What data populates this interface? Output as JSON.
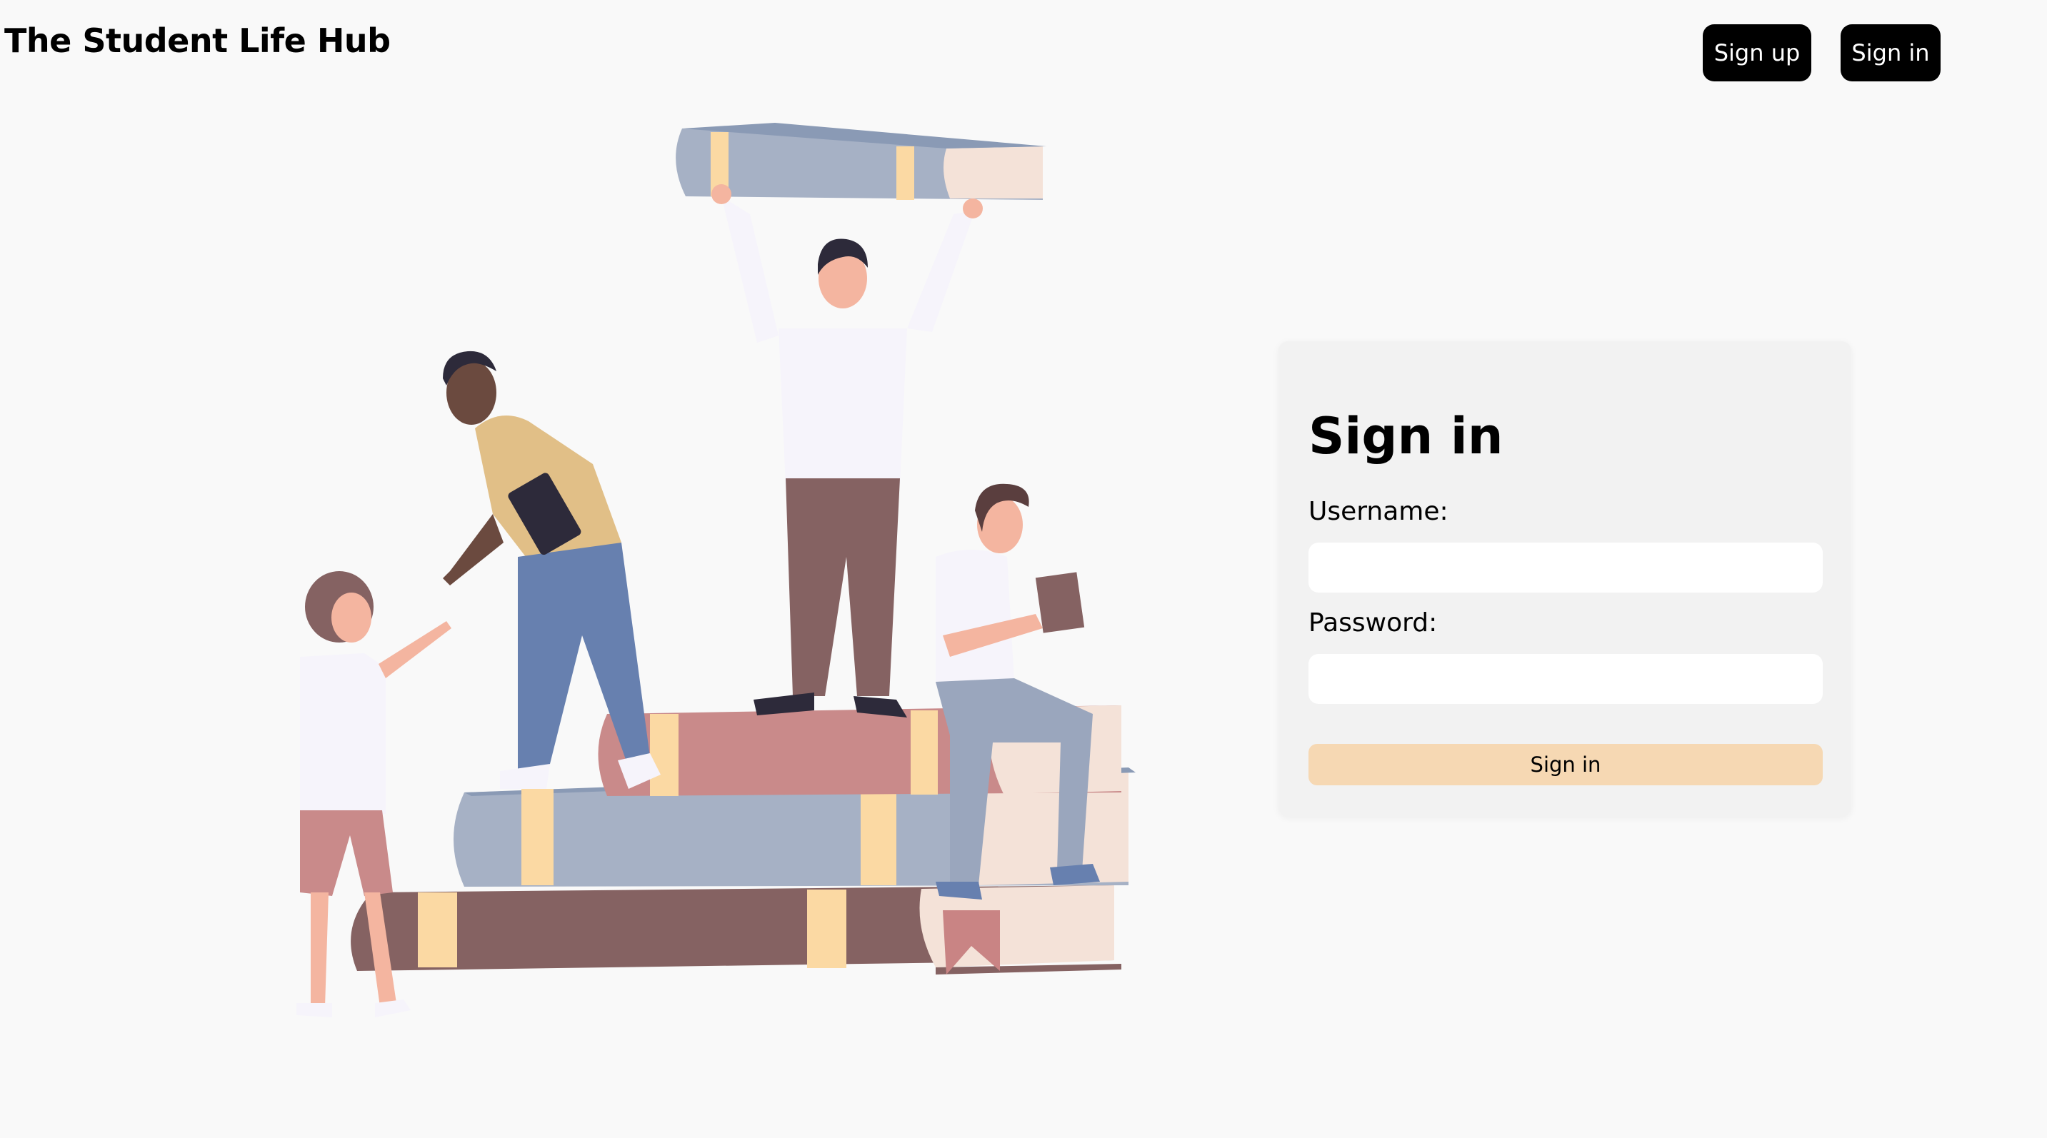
{
  "header": {
    "brand": "The Student Life Hub",
    "signup_label": "Sign up",
    "signin_label": "Sign in"
  },
  "illustration": {
    "icon": "students-on-books-illustration"
  },
  "form": {
    "title": "Sign in",
    "username_label": "Username:",
    "username_value": "",
    "password_label": "Password:",
    "password_value": "",
    "submit_label": "Sign in"
  },
  "colors": {
    "background": "#f9f9f9",
    "card": "#f2f2f2",
    "submit": "#f6d8b3",
    "nav_button": "#000000"
  }
}
